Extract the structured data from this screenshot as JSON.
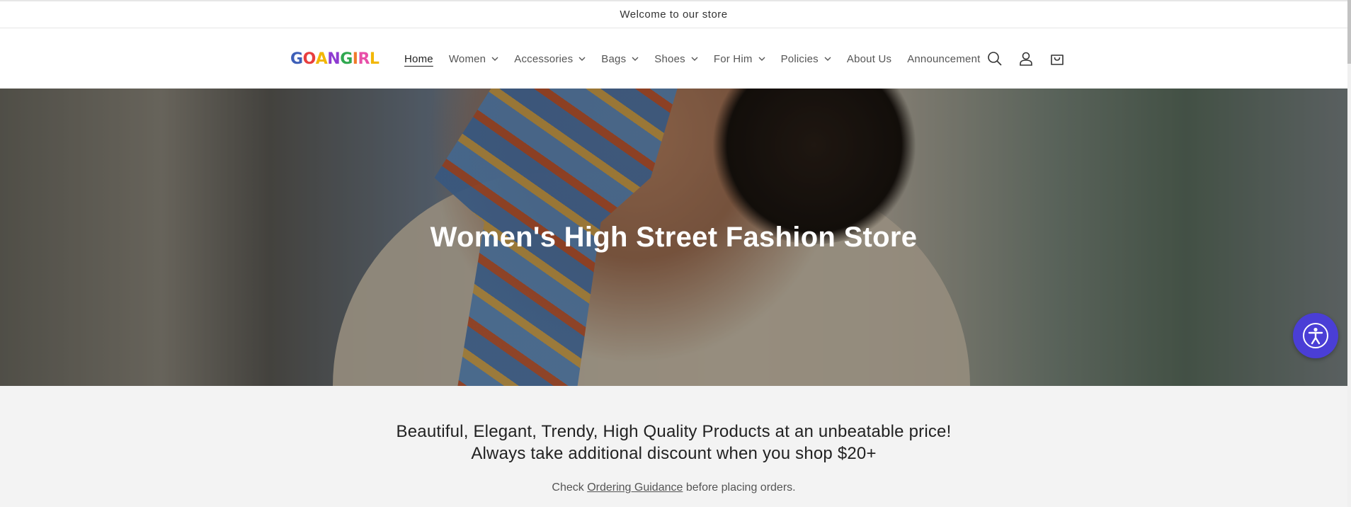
{
  "announcement": {
    "text": "Welcome to our store"
  },
  "header": {
    "logo": {
      "letters": [
        "G",
        "O",
        "A",
        "N",
        "G",
        "I",
        "R",
        "L"
      ]
    },
    "nav": [
      {
        "label": "Home",
        "active": true,
        "dropdown": false
      },
      {
        "label": "Women",
        "dropdown": true
      },
      {
        "label": "Accessories",
        "dropdown": true
      },
      {
        "label": "Bags",
        "dropdown": true
      },
      {
        "label": "Shoes",
        "dropdown": true
      },
      {
        "label": "For Him",
        "dropdown": true
      },
      {
        "label": "Policies",
        "dropdown": true
      },
      {
        "label": "About Us",
        "dropdown": false
      },
      {
        "label": "Announcement",
        "dropdown": false
      }
    ],
    "icons": [
      "search-icon",
      "account-icon",
      "cart-icon"
    ]
  },
  "hero": {
    "title": "Women's High Street Fashion Store"
  },
  "intro": {
    "line1": "Beautiful, Elegant, Trendy, High Quality Products at an unbeatable price!",
    "line2": "Always take additional discount when you shop $20+",
    "note_prefix": "Check ",
    "note_link": "Ordering Guidance",
    "note_suffix": " before placing orders."
  },
  "colors": {
    "accessibility_button": "#4a3ed6",
    "logo": [
      "#3d5fb8",
      "#e83e3e",
      "#f2b705",
      "#8e3bd1",
      "#2fa84f",
      "#f07a2a",
      "#e84fa8",
      "#f2b705"
    ]
  }
}
